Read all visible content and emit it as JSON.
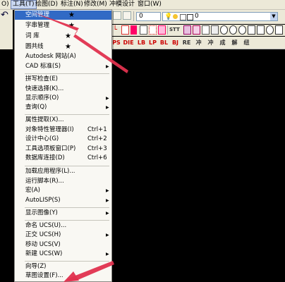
{
  "menubar": {
    "items": [
      {
        "label": "O)",
        "active": false
      },
      {
        "label": "工具(T)",
        "active": true
      },
      {
        "label": "绘图(D)",
        "active": false
      },
      {
        "label": "标注(N)",
        "active": false
      },
      {
        "label": "修改(M)",
        "active": false
      },
      {
        "label": "冲模设计",
        "active": false
      },
      {
        "label": "窗口(W)",
        "active": false
      }
    ]
  },
  "toolbar": {
    "layer_combo": "0",
    "layer_combo_prefix": "0",
    "row3_buttons": [
      "PS",
      "DIE",
      "LB",
      "LP",
      "BL",
      "BJ",
      "RE",
      "冲",
      "冲",
      "成",
      "解",
      "纽"
    ],
    "row2_text": "STT"
  },
  "tools_menu": {
    "items": [
      {
        "label": "空间管理",
        "shortcut": "",
        "submenu": false,
        "star": true
      },
      {
        "label": "字串管理",
        "shortcut": "",
        "submenu": false,
        "star": true
      },
      {
        "label": "词 库",
        "shortcut": "",
        "submenu": false,
        "star": true
      },
      {
        "label": "圆共线",
        "shortcut": "",
        "submenu": false,
        "star": true
      },
      {
        "label": "Autodesk 网站(A)",
        "shortcut": "",
        "submenu": false
      },
      {
        "label": "CAD 标准(S)",
        "shortcut": "",
        "submenu": true
      },
      {
        "label": "拼写检查(E)",
        "shortcut": "",
        "submenu": false
      },
      {
        "label": "快速选择(K)...",
        "shortcut": "",
        "submenu": false
      },
      {
        "label": "显示顺序(O)",
        "shortcut": "",
        "submenu": true
      },
      {
        "label": "查询(Q)",
        "shortcut": "",
        "submenu": true
      },
      {
        "label": "属性提取(X)...",
        "shortcut": "",
        "submenu": false
      },
      {
        "label": "对象特性管理器(I)",
        "shortcut": "Ctrl+1",
        "submenu": false
      },
      {
        "label": "设计中心(G)",
        "shortcut": "Ctrl+2",
        "submenu": false
      },
      {
        "label": "工具选项板窗口(P)",
        "shortcut": "Ctrl+3",
        "submenu": false
      },
      {
        "label": "数据库连接(D)",
        "shortcut": "Ctrl+6",
        "submenu": false
      },
      {
        "label": "加载应用程序(L)...",
        "shortcut": "",
        "submenu": false
      },
      {
        "label": "运行脚本(R)...",
        "shortcut": "",
        "submenu": false
      },
      {
        "label": "宏(A)",
        "shortcut": "",
        "submenu": true
      },
      {
        "label": "AutoLISP(S)",
        "shortcut": "",
        "submenu": true
      },
      {
        "label": "显示图像(Y)",
        "shortcut": "",
        "submenu": true
      },
      {
        "label": "命名 UCS(U)...",
        "shortcut": "",
        "submenu": false
      },
      {
        "label": "正交 UCS(H)",
        "shortcut": "",
        "submenu": true
      },
      {
        "label": "移动 UCS(V)",
        "shortcut": "",
        "submenu": false
      },
      {
        "label": "新建 UCS(W)",
        "shortcut": "",
        "submenu": true
      },
      {
        "label": "向导(Z)",
        "shortcut": "",
        "submenu": false
      },
      {
        "label": "草图设置(F)...",
        "shortcut": "",
        "submenu": false
      }
    ]
  },
  "colors": {
    "menu_bg": "#f9f8f3",
    "highlight": "#316ac5",
    "arrow": "#e0314e",
    "canvas": "#000000"
  }
}
